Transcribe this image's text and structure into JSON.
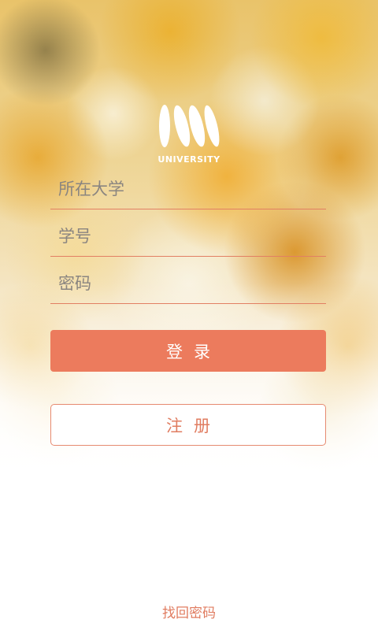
{
  "app": {
    "logo_text": "UNIVERSITY"
  },
  "form": {
    "university_placeholder": "所在大学",
    "university_value": "",
    "student_id_placeholder": "学号",
    "student_id_value": "",
    "password_placeholder": "密码",
    "password_value": ""
  },
  "actions": {
    "login_label": "登录",
    "register_label": "注册",
    "forgot_password_label": "找回密码"
  },
  "colors": {
    "accent": "#ec7b5d",
    "accent_text": "#e07c60",
    "underline": "#e27f63"
  },
  "icons": {
    "logo": "university-logo-icon"
  }
}
